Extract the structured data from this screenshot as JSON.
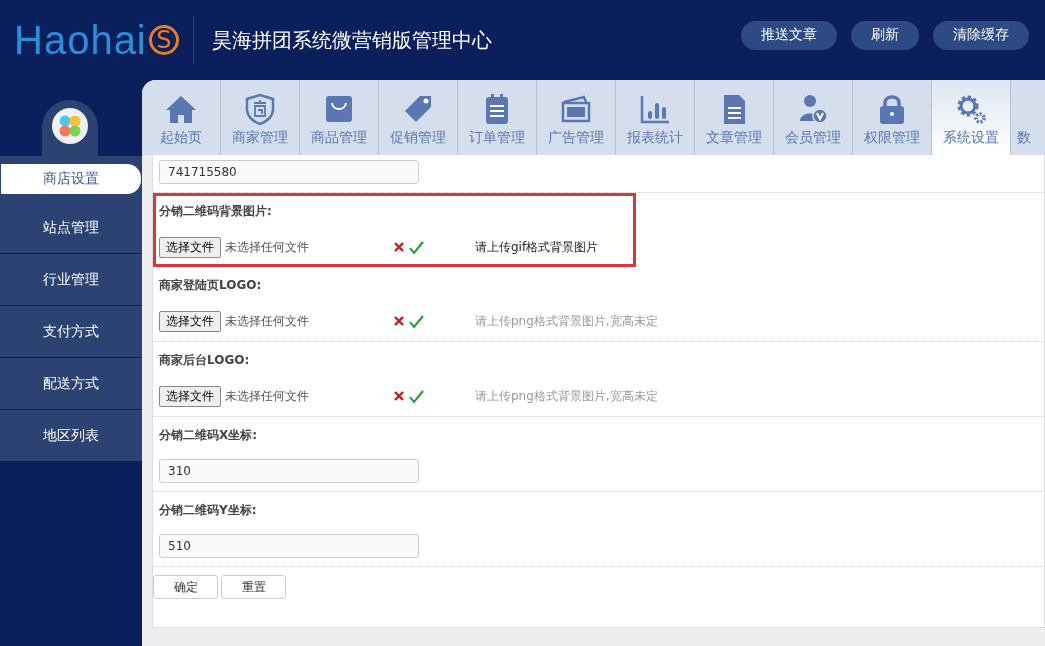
{
  "header": {
    "logo": {
      "text": "Haohai",
      "mark": "S"
    },
    "title": "昊海拼团系统微营销版管理中心",
    "buttons": [
      "推送文章",
      "刷新",
      "清除缓存"
    ]
  },
  "tabs": [
    {
      "label": "起始页",
      "selected": false
    },
    {
      "label": "商家管理",
      "selected": false
    },
    {
      "label": "商品管理",
      "selected": false
    },
    {
      "label": "促销管理",
      "selected": false
    },
    {
      "label": "订单管理",
      "selected": false
    },
    {
      "label": "广告管理",
      "selected": false
    },
    {
      "label": "报表统计",
      "selected": false
    },
    {
      "label": "文章管理",
      "selected": false
    },
    {
      "label": "会员管理",
      "selected": false
    },
    {
      "label": "权限管理",
      "selected": false
    },
    {
      "label": "系统设置",
      "selected": true
    },
    {
      "label": "数",
      "selected": false
    }
  ],
  "sidebar": {
    "items": [
      {
        "label": "商店设置",
        "selected": true
      },
      {
        "label": "站点管理",
        "selected": false
      },
      {
        "label": "行业管理",
        "selected": false
      },
      {
        "label": "支付方式",
        "selected": false
      },
      {
        "label": "配送方式",
        "selected": false
      },
      {
        "label": "地区列表",
        "selected": false
      }
    ]
  },
  "form": {
    "fields": [
      {
        "kind": "text",
        "value": "741715580"
      },
      {
        "kind": "upload",
        "label": "分销二维码背景图片:",
        "button": "选择文件",
        "status": "未选择任何文件",
        "hint": "请上传gif格式背景图片",
        "highlighted": true
      },
      {
        "kind": "upload",
        "label": "商家登陆页LOGO:",
        "button": "选择文件",
        "status": "未选择任何文件",
        "hint": "请上传png格式背景图片,宽高未定",
        "highlighted": false
      },
      {
        "kind": "upload",
        "label": "商家后台LOGO:",
        "button": "选择文件",
        "status": "未选择任何文件",
        "hint": "请上传png格式背景图片,宽高未定",
        "highlighted": false
      },
      {
        "kind": "text",
        "label": "分销二维码X坐标:",
        "value": "310"
      },
      {
        "kind": "text",
        "label": "分销二维码Y坐标:",
        "value": "510"
      }
    ],
    "buttons": [
      "确定",
      "重置"
    ]
  }
}
